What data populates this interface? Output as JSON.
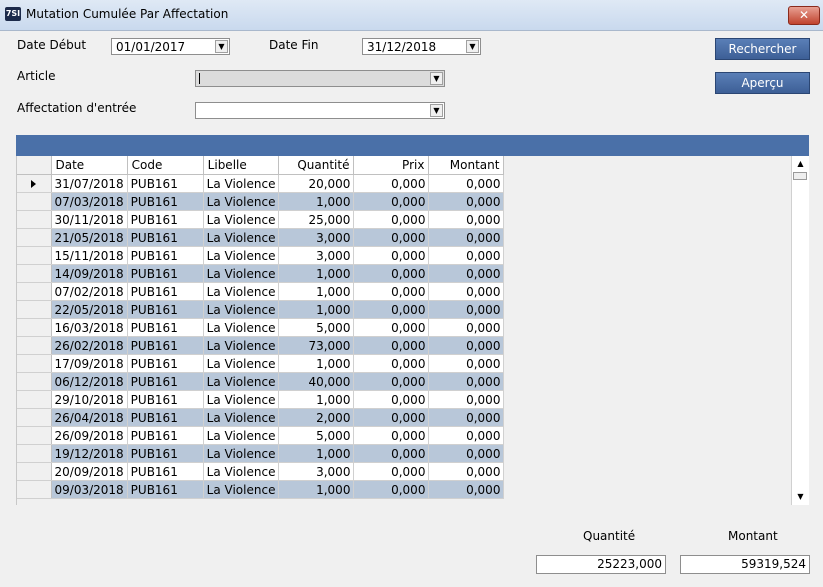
{
  "window": {
    "icon_text": "7SI",
    "title": "Mutation Cumulée Par Affectation",
    "close_label": "✕"
  },
  "filters": {
    "date_debut_label": "Date Début",
    "date_debut_value": "01/01/2017",
    "date_fin_label": "Date Fin",
    "date_fin_value": "31/12/2018",
    "article_label": "Article",
    "article_value": "",
    "affectation_label": "Affectation d'entrée",
    "affectation_value": ""
  },
  "buttons": {
    "rechercher": "Rechercher",
    "apercu": "Aperçu"
  },
  "grid": {
    "columns": [
      "Date",
      "Code",
      "Libelle",
      "Quantité",
      "Prix",
      "Montant"
    ],
    "rows": [
      [
        "31/07/2018",
        "PUB161",
        "La Violence",
        "20,000",
        "0,000",
        "0,000"
      ],
      [
        "07/03/2018",
        "PUB161",
        "La Violence",
        "1,000",
        "0,000",
        "0,000"
      ],
      [
        "30/11/2018",
        "PUB161",
        "La Violence",
        "25,000",
        "0,000",
        "0,000"
      ],
      [
        "21/05/2018",
        "PUB161",
        "La Violence",
        "3,000",
        "0,000",
        "0,000"
      ],
      [
        "15/11/2018",
        "PUB161",
        "La Violence",
        "3,000",
        "0,000",
        "0,000"
      ],
      [
        "14/09/2018",
        "PUB161",
        "La Violence",
        "1,000",
        "0,000",
        "0,000"
      ],
      [
        "07/02/2018",
        "PUB161",
        "La Violence",
        "1,000",
        "0,000",
        "0,000"
      ],
      [
        "22/05/2018",
        "PUB161",
        "La Violence",
        "1,000",
        "0,000",
        "0,000"
      ],
      [
        "16/03/2018",
        "PUB161",
        "La Violence",
        "5,000",
        "0,000",
        "0,000"
      ],
      [
        "26/02/2018",
        "PUB161",
        "La Violence",
        "73,000",
        "0,000",
        "0,000"
      ],
      [
        "17/09/2018",
        "PUB161",
        "La Violence",
        "1,000",
        "0,000",
        "0,000"
      ],
      [
        "06/12/2018",
        "PUB161",
        "La Violence",
        "40,000",
        "0,000",
        "0,000"
      ],
      [
        "29/10/2018",
        "PUB161",
        "La Violence",
        "1,000",
        "0,000",
        "0,000"
      ],
      [
        "26/04/2018",
        "PUB161",
        "La Violence",
        "2,000",
        "0,000",
        "0,000"
      ],
      [
        "26/09/2018",
        "PUB161",
        "La Violence",
        "5,000",
        "0,000",
        "0,000"
      ],
      [
        "19/12/2018",
        "PUB161",
        "La Violence",
        "1,000",
        "0,000",
        "0,000"
      ],
      [
        "20/09/2018",
        "PUB161",
        "La Violence",
        "3,000",
        "0,000",
        "0,000"
      ],
      [
        "09/03/2018",
        "PUB161",
        "La Violence",
        "1,000",
        "0,000",
        "0,000"
      ]
    ]
  },
  "totals": {
    "quantite_label": "Quantité",
    "quantite_value": "25223,000",
    "montant_label": "Montant",
    "montant_value": "59319,524"
  },
  "colors": {
    "header_bar": "#4a70a8",
    "alt_row": "#b8c7d9",
    "button": "#3d5f96"
  }
}
